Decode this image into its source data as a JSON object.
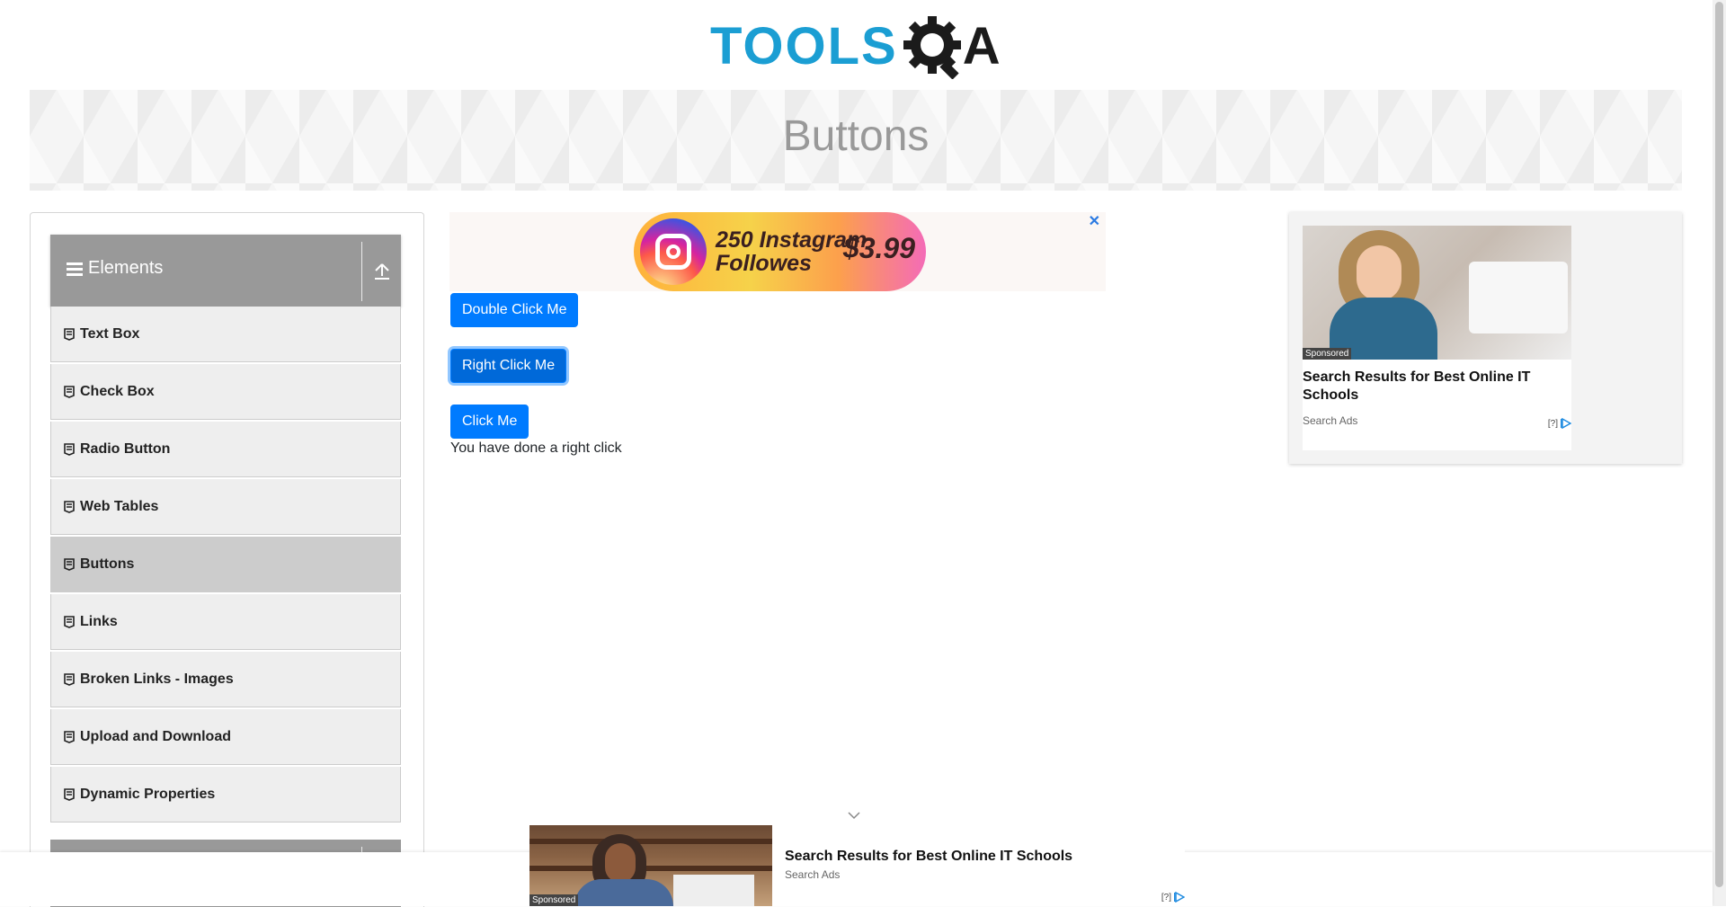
{
  "header": {
    "logo_word": "TOOLS",
    "logo_letter": "A"
  },
  "banner": {
    "title": "Buttons"
  },
  "sidebar": {
    "group_title": "Elements",
    "items": [
      {
        "label": "Text Box"
      },
      {
        "label": "Check Box"
      },
      {
        "label": "Radio Button"
      },
      {
        "label": "Web Tables"
      },
      {
        "label": "Buttons",
        "active": true
      },
      {
        "label": "Links"
      },
      {
        "label": "Broken Links - Images"
      },
      {
        "label": "Upload and Download"
      },
      {
        "label": "Dynamic Properties"
      }
    ]
  },
  "top_ad": {
    "text_line1": "250 Instagram",
    "text_line2": "Followes",
    "price": "$3.99",
    "close": "✕"
  },
  "buttons": {
    "double_click": "Double Click Me",
    "right_click": "Right Click Me",
    "click": "Click Me"
  },
  "result_message": "You have done a right click",
  "right_ad": {
    "badge": "Sponsored",
    "headline": "Search Results for Best Online IT Schools",
    "source": "Search Ads",
    "adchoice": "[?]"
  },
  "bottom_ad": {
    "badge": "Sponsored",
    "headline": "Search Results for Best Online IT Schools",
    "source": "Search Ads",
    "adchoice": "[?]"
  },
  "colors": {
    "brand_blue": "#1b9ed3",
    "button_blue": "#007bff",
    "sidebar_header": "#999999"
  }
}
